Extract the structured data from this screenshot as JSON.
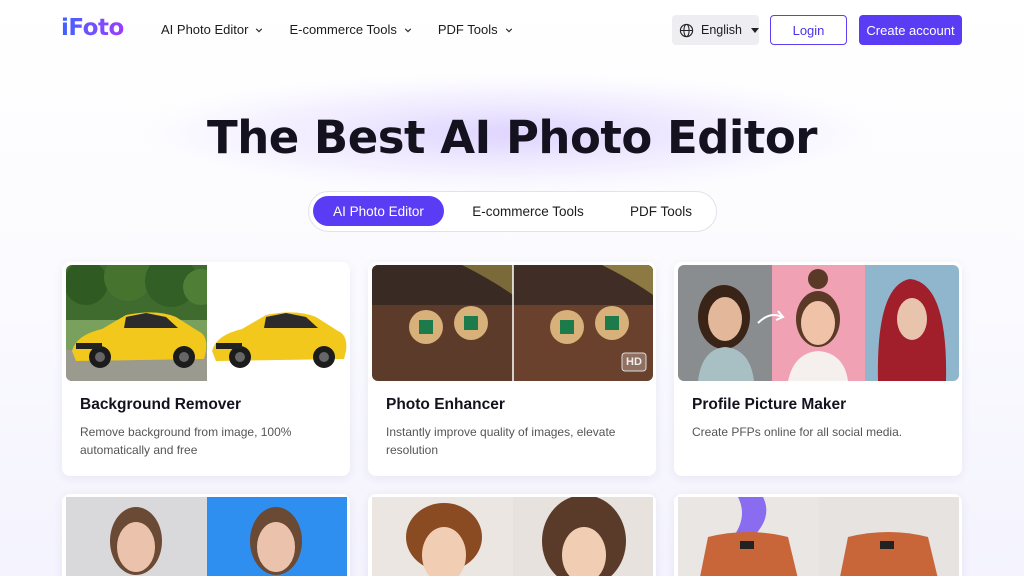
{
  "header": {
    "logo": "iFoto",
    "nav": [
      {
        "label": "AI Photo Editor"
      },
      {
        "label": "E-commerce Tools"
      },
      {
        "label": "PDF Tools"
      }
    ],
    "language": "English",
    "login_label": "Login",
    "create_label": "Create account"
  },
  "hero": {
    "title": "The Best AI Photo Editor",
    "tabs": [
      {
        "label": "AI Photo Editor",
        "active": true
      },
      {
        "label": "E-commerce Tools",
        "active": false
      },
      {
        "label": "PDF Tools",
        "active": false
      }
    ]
  },
  "cards": [
    {
      "title": "Background Remover",
      "description": "Remove background from image, 100% automatically and free"
    },
    {
      "title": "Photo Enhancer",
      "description": "Instantly improve quality of images, elevate resolution",
      "badge": "HD"
    },
    {
      "title": "Profile Picture Maker",
      "description": "Create PFPs online for all social media."
    }
  ],
  "colors": {
    "accent": "#5b3cf5",
    "title": "#14121f"
  }
}
